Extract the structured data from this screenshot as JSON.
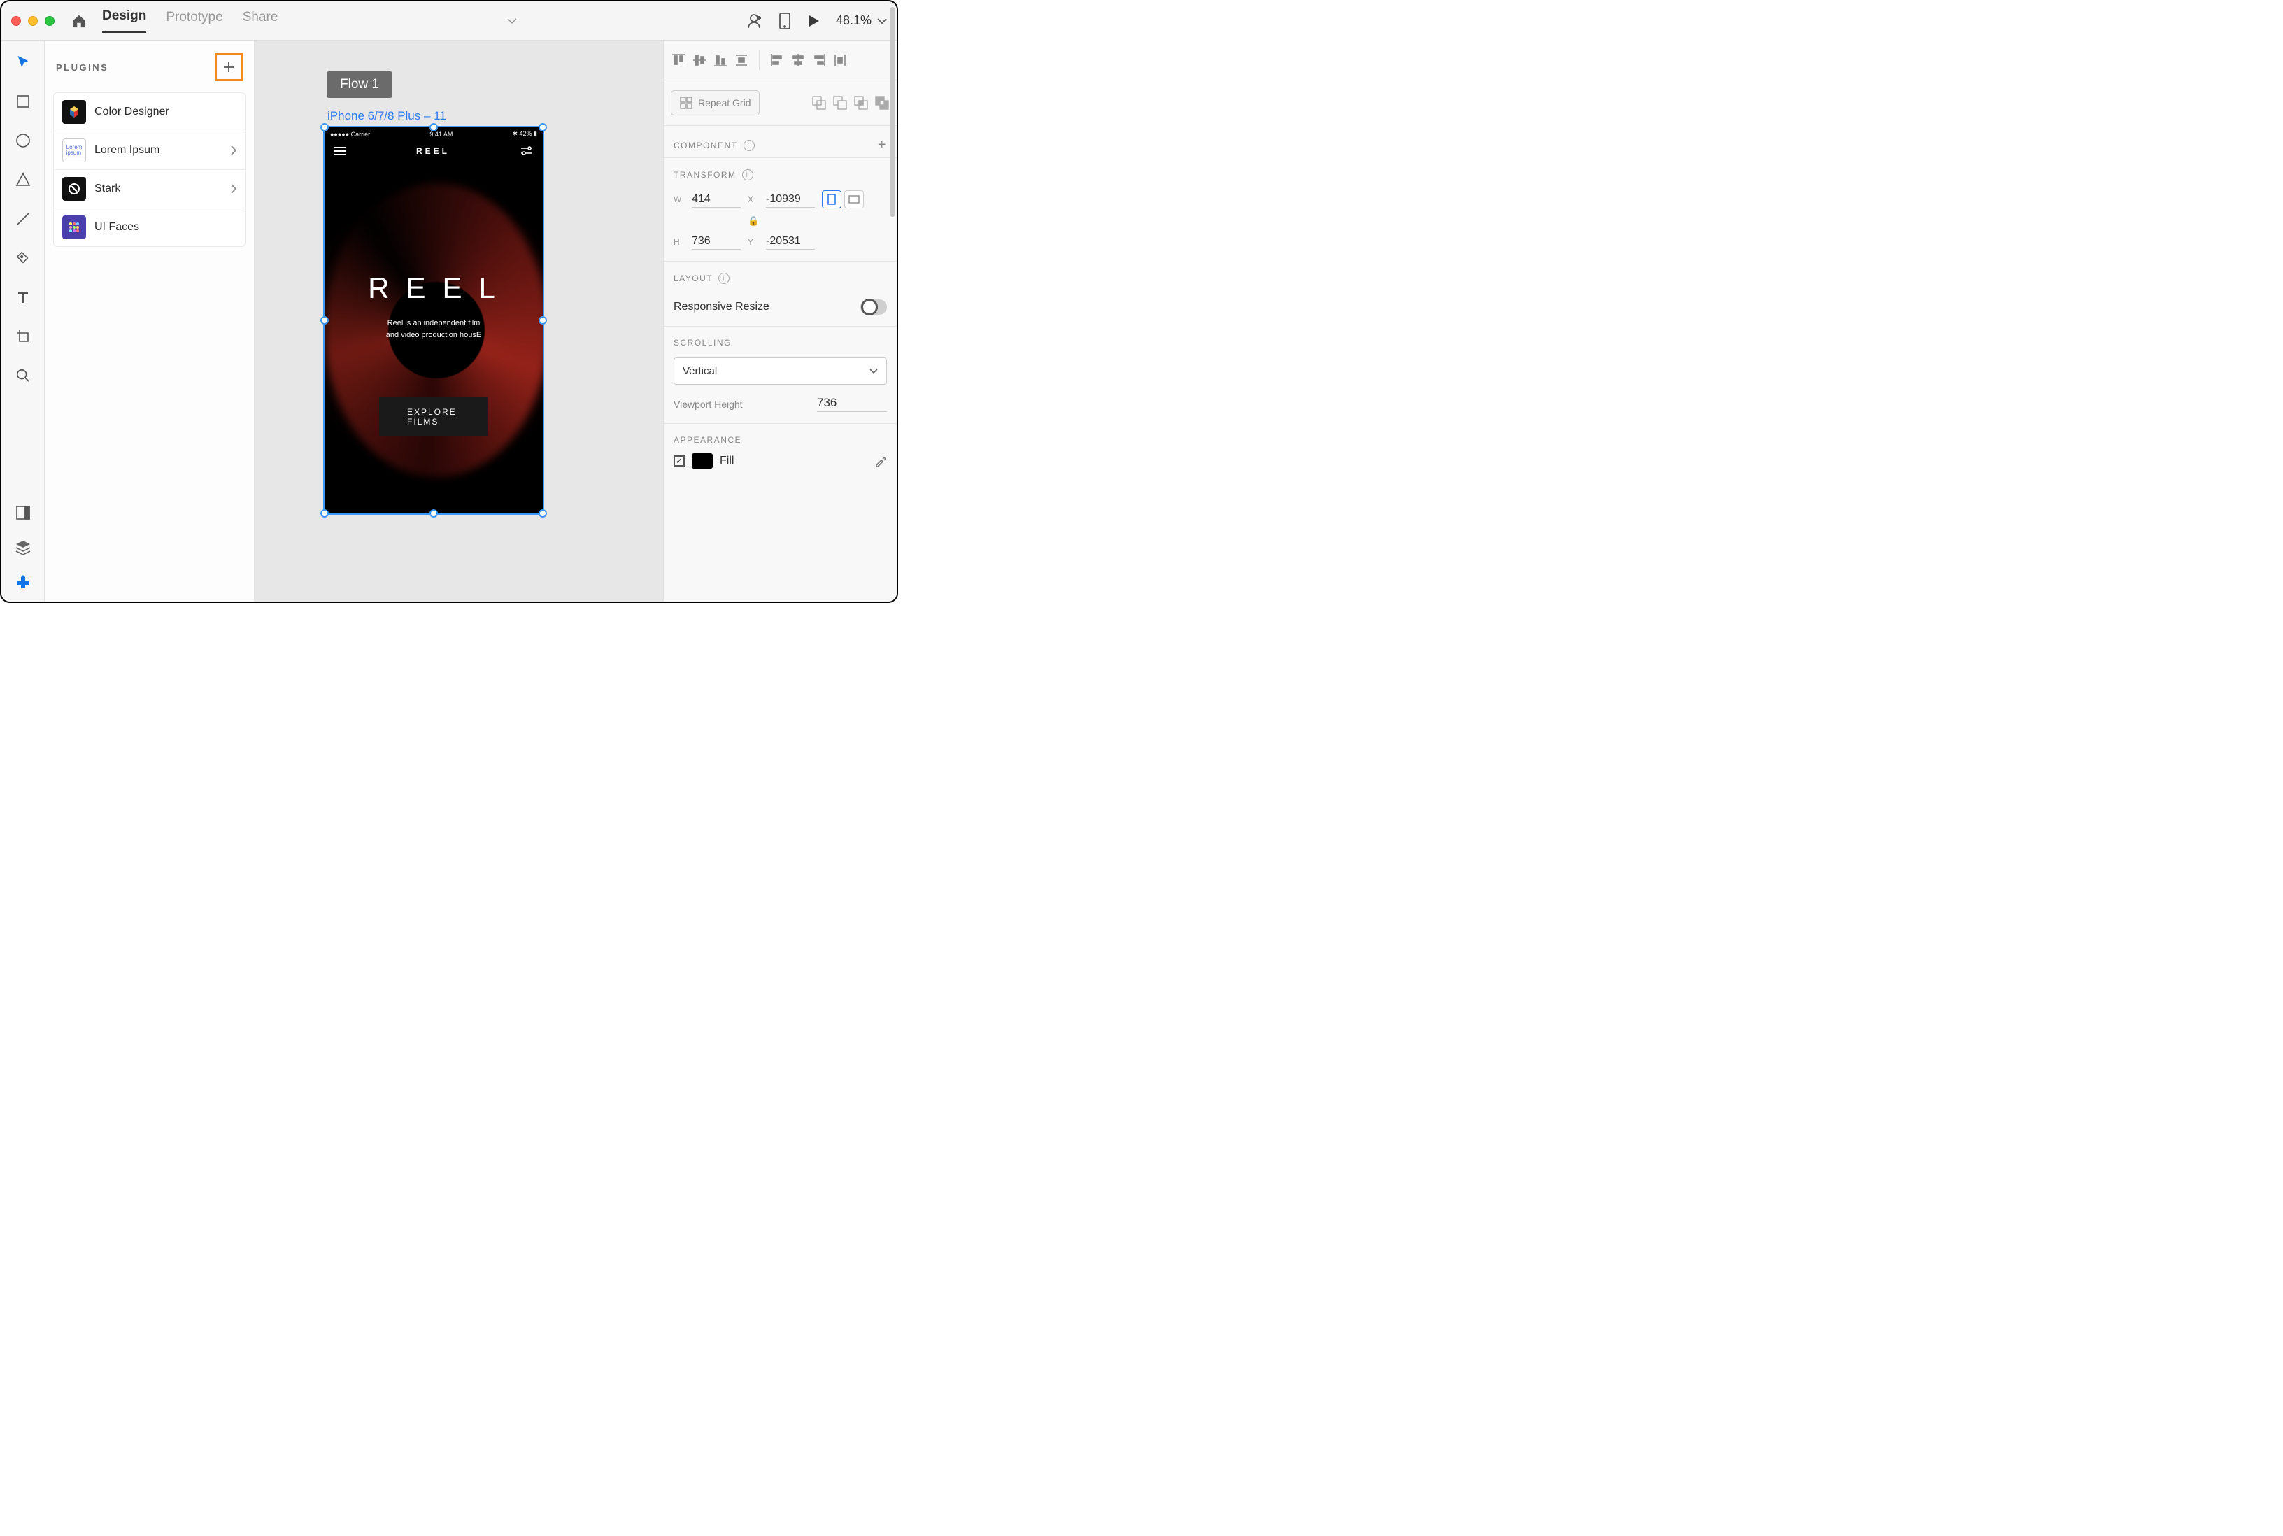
{
  "titlebar": {
    "tabs": {
      "design": "Design",
      "prototype": "Prototype",
      "share": "Share"
    },
    "zoom": "48.1%"
  },
  "leftPanel": {
    "title": "PLUGINS",
    "items": [
      {
        "name": "Color Designer",
        "hasSub": false
      },
      {
        "name": "Lorem Ipsum",
        "hasSub": true
      },
      {
        "name": "Stark",
        "hasSub": true
      },
      {
        "name": "UI Faces",
        "hasSub": false
      }
    ]
  },
  "canvas": {
    "flowLabel": "Flow 1",
    "artboardName": "iPhone 6/7/8 Plus – 11",
    "statusCarrier": "●●●●● Carrier",
    "statusTime": "9:41 AM",
    "statusBattery": "42%",
    "appTitle": "REEL",
    "heroTitle": "REEL",
    "heroSub1": "Reel is an independent film",
    "heroSub2": "and video production housE",
    "cta": "EXPLORE FILMS"
  },
  "rightPanel": {
    "repeatGrid": "Repeat Grid",
    "componentHead": "COMPONENT",
    "transformHead": "TRANSFORM",
    "w": "414",
    "h": "736",
    "x": "-10939",
    "y": "-20531",
    "wL": "W",
    "hL": "H",
    "xL": "X",
    "yL": "Y",
    "layoutHead": "LAYOUT",
    "responsive": "Responsive Resize",
    "scrollingHead": "SCROLLING",
    "scrollingValue": "Vertical",
    "viewportHeightLabel": "Viewport Height",
    "viewportHeight": "736",
    "appearanceHead": "APPEARANCE",
    "fillLabel": "Fill"
  }
}
